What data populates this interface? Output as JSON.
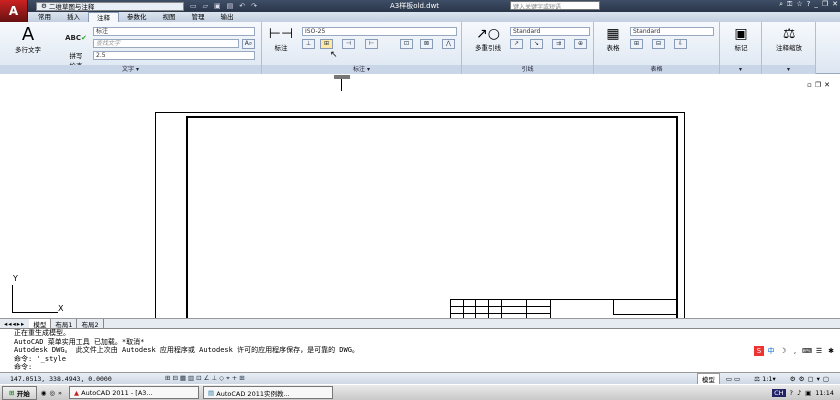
{
  "app": {
    "logo": "A",
    "workspace": "二维草图与注释",
    "document_title": "A3样板old.dwt",
    "search_placeholder": "键入关键字或短语"
  },
  "tabs": [
    "常用",
    "插入",
    "注释",
    "参数化",
    "视图",
    "管理",
    "输出"
  ],
  "ribbon": {
    "text_panel": {
      "multiline_text": "多行文字",
      "check_spelling": "拼写\n检查",
      "text_style": "标注",
      "find_text": "查找文字",
      "height": "2.5",
      "label": "文字"
    },
    "dim_panel": {
      "dim_button": "标注",
      "dim_style": "ISO-25",
      "label": "标注"
    },
    "leader_panel": {
      "multileader": "多重引线",
      "leader_style": "Standard",
      "label": "引线"
    },
    "table_panel": {
      "table": "表格",
      "table_style": "Standard",
      "label": "表格"
    },
    "markup_panel": {
      "markup": "标记"
    },
    "scale_panel": {
      "annotation_scale": "注释缩放"
    }
  },
  "layout_tabs": [
    "模型",
    "布局1",
    "布局2"
  ],
  "command_lines": [
    "正在重生成模型。",
    "AutoCAD 菜单实用工具 已加载。*取消*",
    "Autodesk DWG。  此文件上次由 Autodesk 应用程序或 Autodesk 许可的应用程序保存，是可靠的 DWG。",
    "命令: '_style",
    "命令:"
  ],
  "status": {
    "coordinates": "147.0513,  338.4943, 0.0000",
    "model_label": "模型",
    "annotation_scale": "1:1"
  },
  "ucs": {
    "x": "X",
    "y": "Y"
  },
  "taskbar": {
    "start": "开始",
    "tasks": [
      "AutoCAD 2011 - [A3...",
      "AutoCAD 2011实例教..."
    ],
    "clock": "11:14",
    "lang": "CH"
  },
  "ime": [
    "S",
    "中"
  ]
}
